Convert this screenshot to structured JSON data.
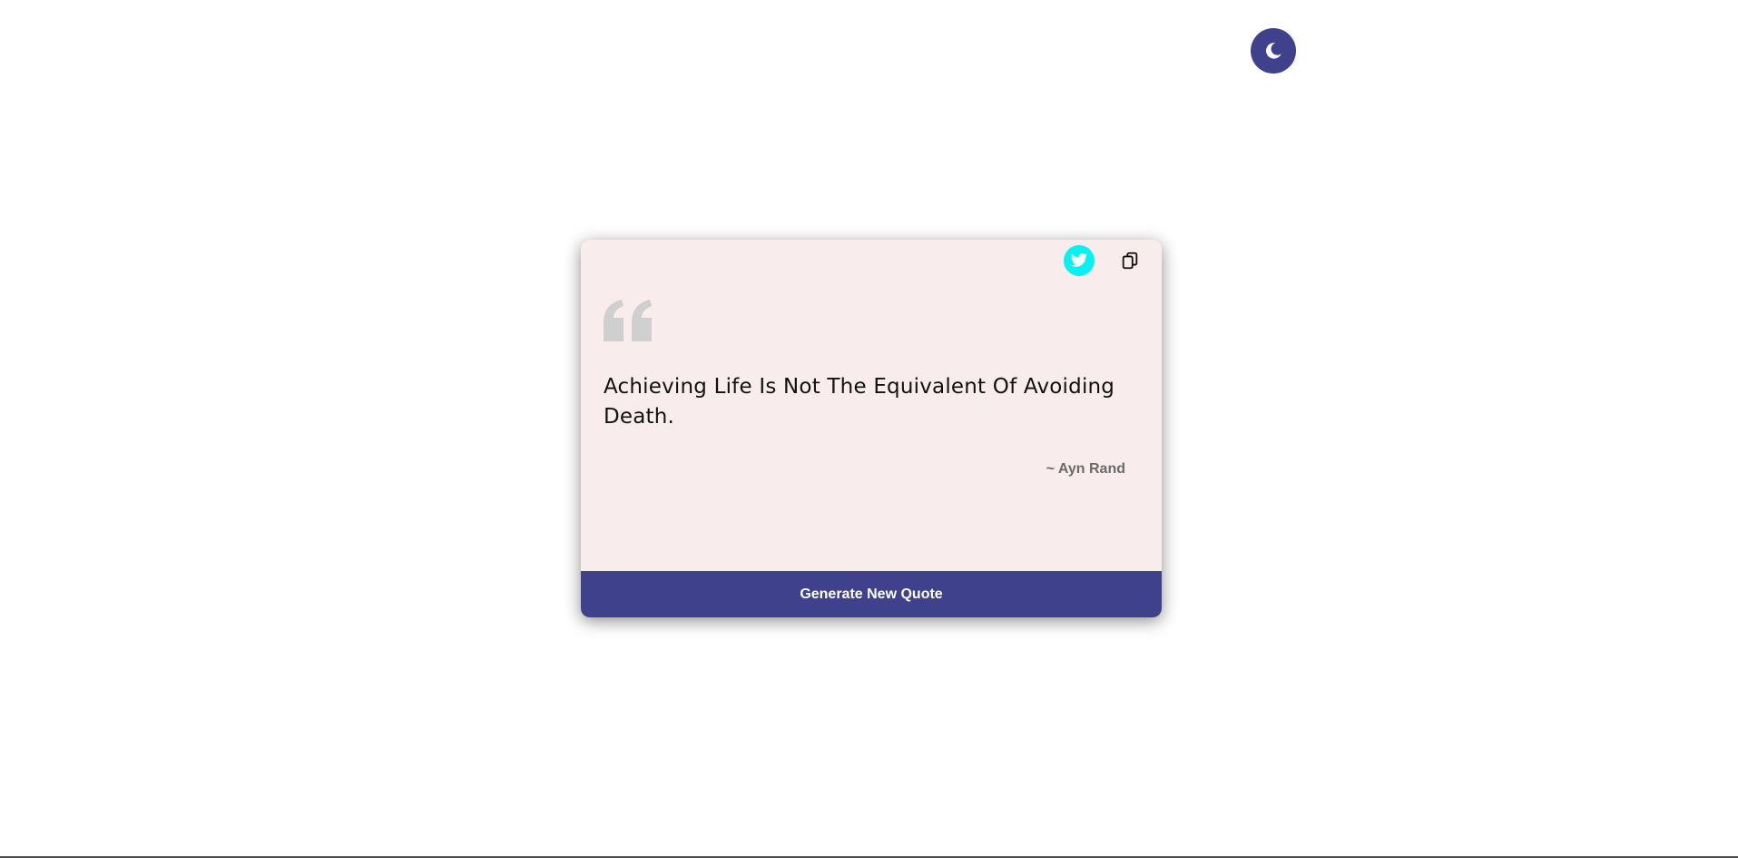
{
  "theme_toggle": {
    "icon": "moon-icon",
    "color": "#40418d"
  },
  "card": {
    "background": "#f8ecec",
    "actions": {
      "twitter_icon": "twitter-icon",
      "twitter_color": "#06f2f2",
      "copy_icon": "copy-icon"
    },
    "quote_icon": "quote-mark-icon",
    "quote": "Achieving Life Is Not The Equivalent Of Avoiding Death.",
    "author": "~ Ayn Rand",
    "generate_button_label": "Generate New Quote",
    "accent": "#40418d"
  }
}
